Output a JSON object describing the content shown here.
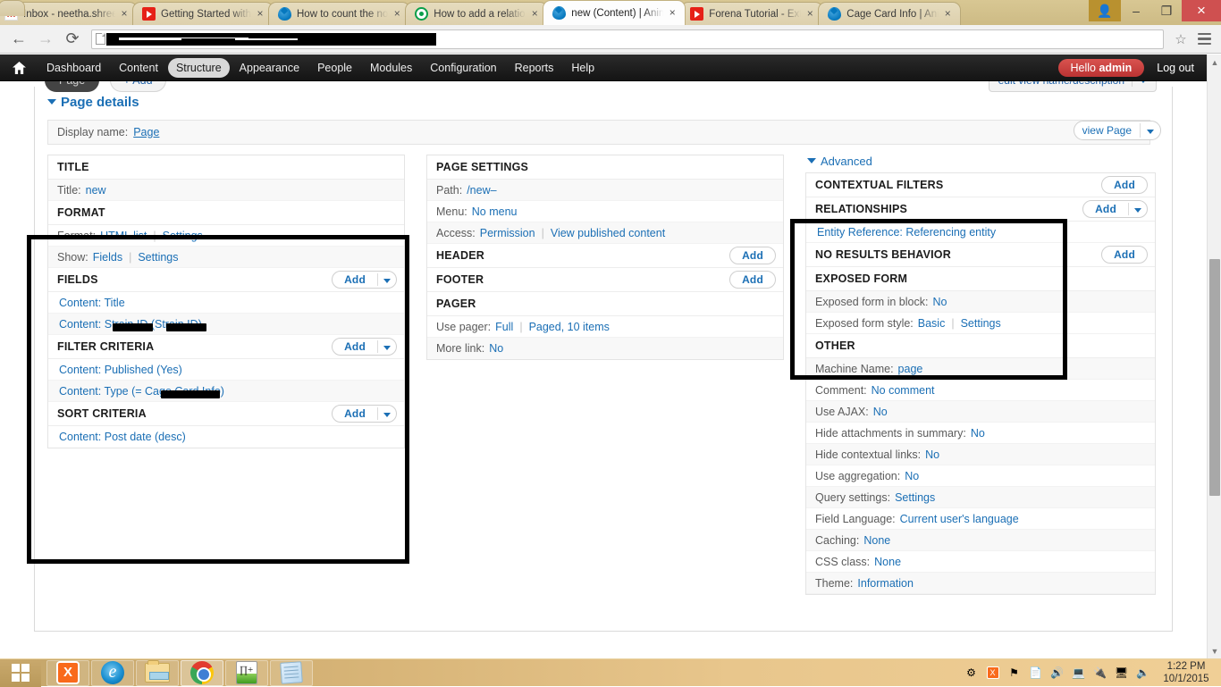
{
  "browser": {
    "tabs": [
      {
        "title": "Inbox - neetha.shree(",
        "favicon": "gmail-icon",
        "active": false
      },
      {
        "title": "Getting Started with ",
        "favicon": "youtube-icon",
        "active": false
      },
      {
        "title": "How to count the no",
        "favicon": "drupal-icon",
        "active": false
      },
      {
        "title": "How to add a relation",
        "favicon": "green-circle-icon",
        "active": false
      },
      {
        "title": "new (Content) | Anim",
        "favicon": "drupal-icon",
        "active": true
      },
      {
        "title": "Forena Tutorial - Exte",
        "favicon": "youtube-icon",
        "active": false
      },
      {
        "title": "Cage Card Info | Anin",
        "favicon": "drupal-icon",
        "active": false
      }
    ],
    "tab_close_label": "×",
    "new_tab_label": "",
    "window_controls": {
      "profile": "▲",
      "minimize": "–",
      "maximize": "❐",
      "close": "×"
    },
    "nav": {
      "back": "←",
      "forward": "→",
      "reload": "⟳"
    },
    "omnibox": {
      "value": "",
      "placeholder": "",
      "redacted": true
    },
    "star_icon": "☆",
    "menu_icon": "hamburger-menu-icon"
  },
  "admin_toolbar": {
    "home_icon": "home-icon",
    "items": [
      {
        "label": "Dashboard",
        "active": false
      },
      {
        "label": "Content",
        "active": false
      },
      {
        "label": "Structure",
        "active": true
      },
      {
        "label": "Appearance",
        "active": false
      },
      {
        "label": "People",
        "active": false
      },
      {
        "label": "Modules",
        "active": false
      },
      {
        "label": "Configuration",
        "active": false
      },
      {
        "label": "Reports",
        "active": false
      },
      {
        "label": "Help",
        "active": false
      }
    ],
    "greeting_prefix": "Hello ",
    "greeting_user": "admin",
    "logout": "Log out"
  },
  "view_tabs": {
    "page_tab": "Page",
    "add_tab": "+ Add",
    "edit_name_btn": "edit view name/description"
  },
  "page_details": {
    "heading": "Page details",
    "display_name_label": "Display name:",
    "display_name_value": "Page",
    "view_page_button": "view Page"
  },
  "column1": {
    "title_section": {
      "heading": "TITLE",
      "rows": [
        {
          "label": "Title:",
          "links": [
            "new"
          ]
        }
      ]
    },
    "format_section": {
      "heading": "FORMAT",
      "rows": [
        {
          "label": "Format:",
          "links": [
            "HTML list",
            "Settings"
          ]
        },
        {
          "label": "Show:",
          "links": [
            "Fields",
            "Settings"
          ]
        }
      ]
    },
    "fields_section": {
      "heading": "FIELDS",
      "add_label": "Add",
      "rows": [
        {
          "text": "Content: Title",
          "redacted": false
        },
        {
          "text": "Content: Strain ID (Strain ID)",
          "redacted": true
        }
      ]
    },
    "filter_section": {
      "heading": "FILTER CRITERIA",
      "add_label": "Add",
      "rows": [
        {
          "text": "Content: Published (Yes)",
          "redacted": false
        },
        {
          "text": "Content: Type (= Cage Card Info)",
          "redacted": true
        }
      ]
    },
    "sort_section": {
      "heading": "SORT CRITERIA",
      "add_label": "Add",
      "rows": [
        {
          "text": "Content: Post date (desc)",
          "redacted": false
        }
      ]
    }
  },
  "column2": {
    "page_settings": {
      "heading": "PAGE SETTINGS",
      "rows": [
        {
          "label": "Path:",
          "links": [
            "/new–"
          ]
        },
        {
          "label": "Menu:",
          "links": [
            "No menu"
          ]
        },
        {
          "label": "Access:",
          "links": [
            "Permission",
            "View published content"
          ]
        }
      ]
    },
    "header": {
      "heading": "HEADER",
      "add_label": "Add"
    },
    "footer": {
      "heading": "FOOTER",
      "add_label": "Add"
    },
    "pager": {
      "heading": "PAGER",
      "rows": [
        {
          "label": "Use pager:",
          "links": [
            "Full",
            "Paged, 10 items"
          ]
        },
        {
          "label": "More link:",
          "links": [
            "No"
          ]
        }
      ]
    }
  },
  "column3": {
    "advanced_heading": "Advanced",
    "contextual_filters": {
      "heading": "CONTEXTUAL FILTERS",
      "add_label": "Add"
    },
    "relationships": {
      "heading": "RELATIONSHIPS",
      "add_label": "Add",
      "rows": [
        {
          "text": "Entity Reference: Referencing entity"
        }
      ]
    },
    "no_results": {
      "heading": "NO RESULTS BEHAVIOR",
      "add_label": "Add"
    },
    "exposed_form": {
      "heading": "EXPOSED FORM",
      "rows": [
        {
          "label": "Exposed form in block:",
          "links": [
            "No"
          ]
        },
        {
          "label": "Exposed form style:",
          "links": [
            "Basic",
            "Settings"
          ]
        }
      ]
    },
    "other": {
      "heading": "OTHER",
      "rows": [
        {
          "label": "Machine Name:",
          "links": [
            "page"
          ]
        },
        {
          "label": "Comment:",
          "links": [
            "No comment"
          ]
        },
        {
          "label": "Use AJAX:",
          "links": [
            "No"
          ]
        },
        {
          "label": "Hide attachments in summary:",
          "links": [
            "No"
          ]
        },
        {
          "label": "Hide contextual links:",
          "links": [
            "No"
          ]
        },
        {
          "label": "Use aggregation:",
          "links": [
            "No"
          ]
        },
        {
          "label": "Query settings:",
          "links": [
            "Settings"
          ]
        },
        {
          "label": "Field Language:",
          "links": [
            "Current user's language"
          ]
        },
        {
          "label": "Caching:",
          "links": [
            "None"
          ]
        },
        {
          "label": "CSS class:",
          "links": [
            "None"
          ]
        },
        {
          "label": "Theme:",
          "links": [
            "Information"
          ]
        }
      ]
    }
  },
  "taskbar": {
    "start_icon": "windows-start-icon",
    "items": [
      {
        "icon": "xampp-icon",
        "running": false
      },
      {
        "icon": "internet-explorer-icon",
        "running": false
      },
      {
        "icon": "file-explorer-icon",
        "running": false
      },
      {
        "icon": "chrome-icon",
        "running": true
      },
      {
        "icon": "notepadpp-icon",
        "running": false
      },
      {
        "icon": "notepad-icon",
        "running": false
      }
    ],
    "tray": [
      "show-hidden-icon",
      "xampp-tray-icon",
      "flag-error-icon",
      "office-icon",
      "volume-icon",
      "display-icon",
      "usb-icon",
      "network-icon",
      "speaker-icon"
    ],
    "time": "1:22 PM",
    "date": "10/1/2015"
  },
  "colors": {
    "link": "#1b6fb5",
    "accent_red": "#c9423f",
    "taskbar": "#e0bd80"
  }
}
